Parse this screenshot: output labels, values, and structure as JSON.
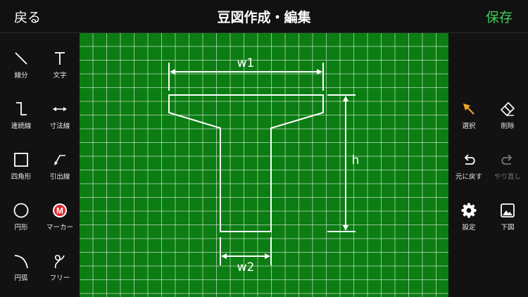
{
  "header": {
    "back_label": "戻る",
    "title": "豆図作成・編集",
    "save_label": "保存"
  },
  "left_tools": [
    {
      "label": "線分",
      "icon": "line-icon"
    },
    {
      "label": "文字",
      "icon": "text-icon"
    },
    {
      "label": "連続線",
      "icon": "polyline-icon"
    },
    {
      "label": "寸法線",
      "icon": "dimension-line-icon"
    },
    {
      "label": "四角形",
      "icon": "rectangle-icon"
    },
    {
      "label": "引出線",
      "icon": "leader-line-icon"
    },
    {
      "label": "円形",
      "icon": "circle-icon"
    },
    {
      "label": "マーカー",
      "icon": "marker-icon"
    },
    {
      "label": "円弧",
      "icon": "arc-icon"
    },
    {
      "label": "フリー",
      "icon": "freehand-icon"
    }
  ],
  "right_tools": [
    {
      "label": "選択",
      "icon": "select-arrow-icon"
    },
    {
      "label": "削除",
      "icon": "eraser-icon"
    },
    {
      "label": "元に戻す",
      "icon": "undo-icon"
    },
    {
      "label": "やり直し",
      "icon": "redo-icon",
      "disabled": true
    },
    {
      "label": "設定",
      "icon": "gear-icon"
    },
    {
      "label": "下図",
      "icon": "image-icon"
    }
  ],
  "drawing": {
    "labels": {
      "top_width": "w1",
      "height": "h",
      "bottom_width": "w2"
    },
    "grid_color": "#0b7d12",
    "marker_letter": "M"
  },
  "colors": {
    "accent_save": "#3fcf5a",
    "select_icon": "#f5a623",
    "marker": "#e0262b"
  }
}
